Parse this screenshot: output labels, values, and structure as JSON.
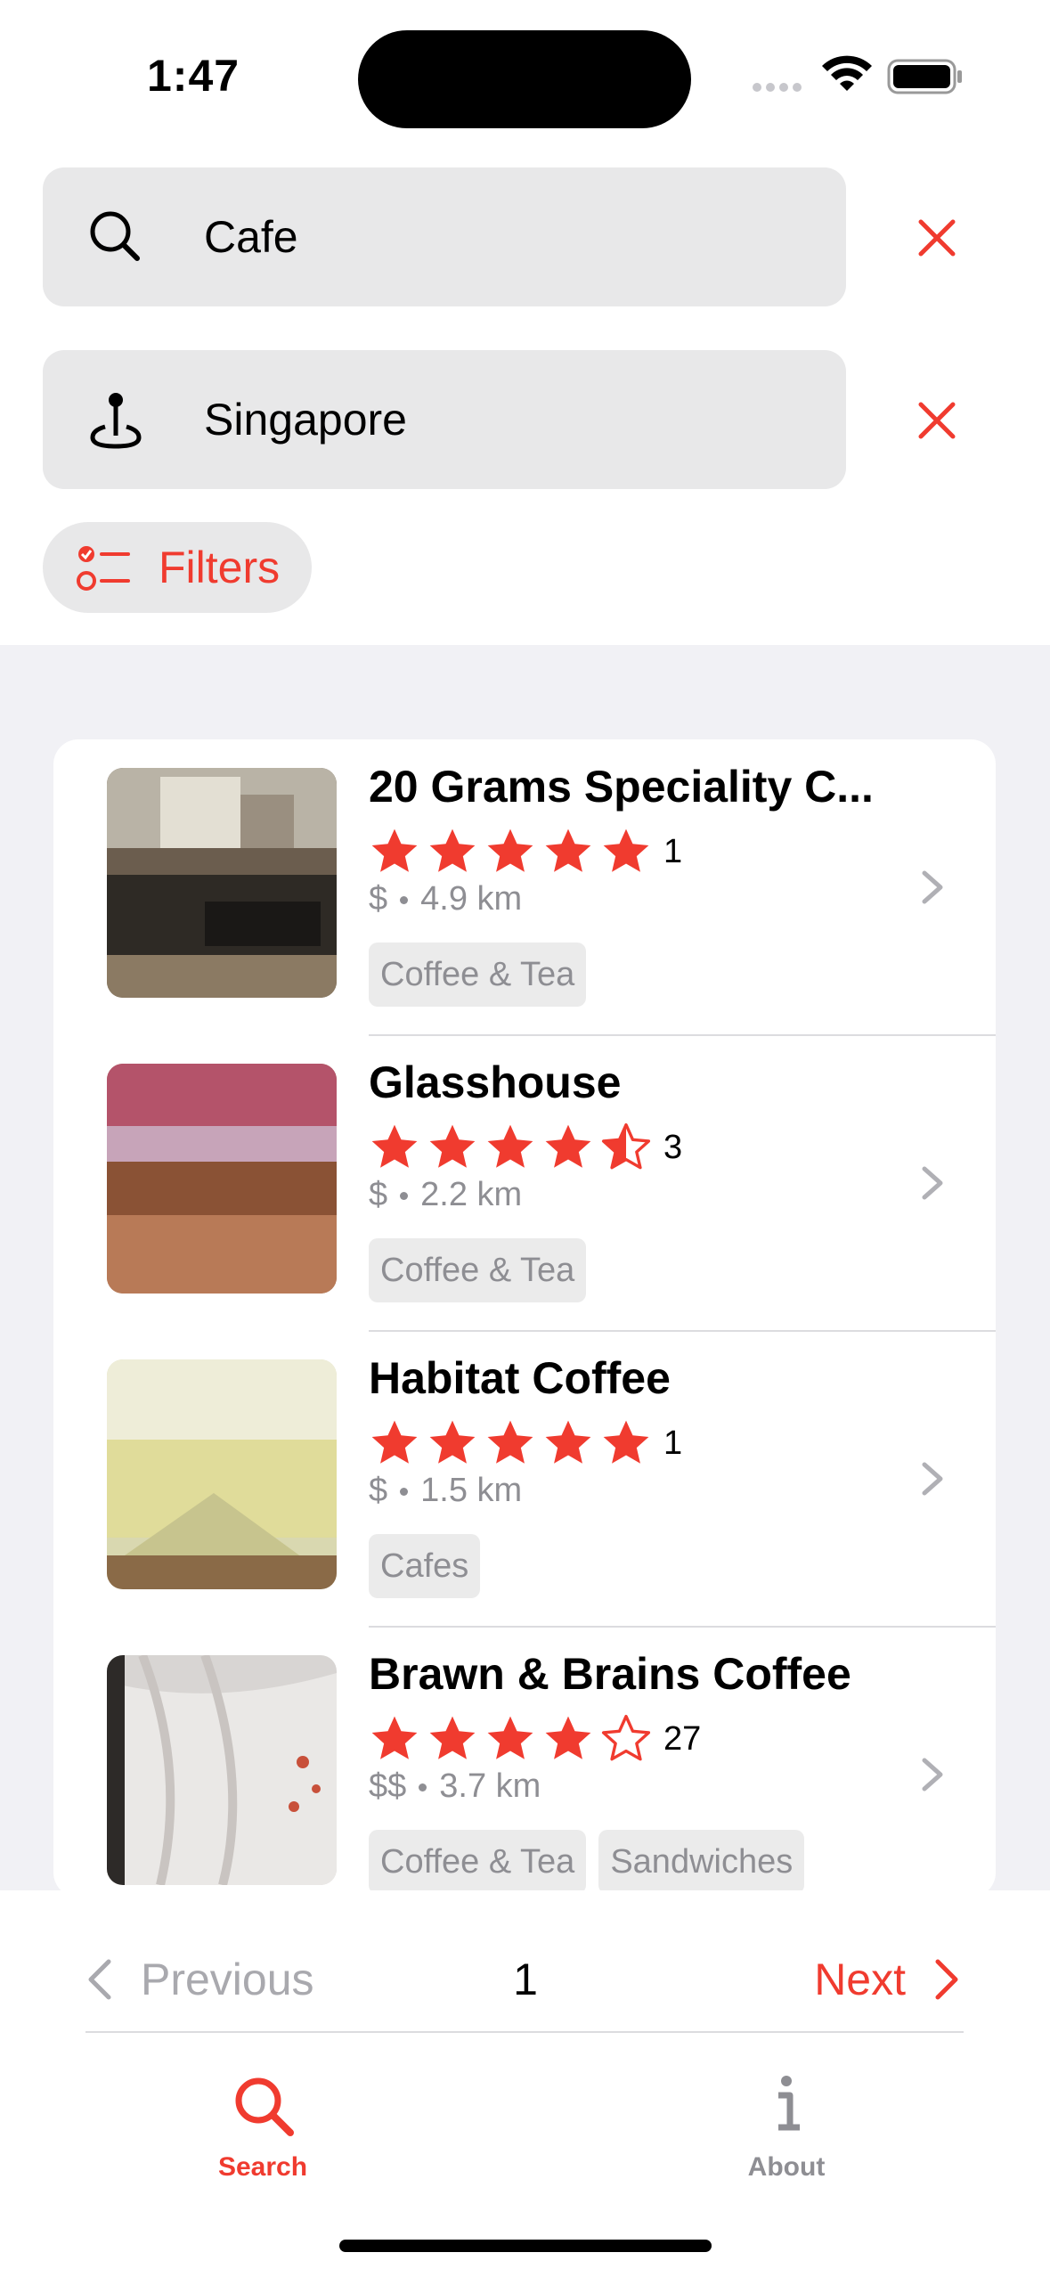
{
  "status": {
    "time": "1:47"
  },
  "search": {
    "query": "Cafe",
    "location": "Singapore",
    "filters_label": "Filters"
  },
  "results": [
    {
      "name": "20 Grams Speciality C...",
      "rating": 5,
      "reviews": "1",
      "price": "$",
      "distance": "4.9 km",
      "tags": [
        "Coffee & Tea"
      ]
    },
    {
      "name": "Glasshouse",
      "rating": 4.5,
      "reviews": "3",
      "price": "$",
      "distance": "2.2 km",
      "tags": [
        "Coffee & Tea"
      ]
    },
    {
      "name": "Habitat Coffee",
      "rating": 5,
      "reviews": "1",
      "price": "$",
      "distance": "1.5 km",
      "tags": [
        "Cafes"
      ]
    },
    {
      "name": "Brawn & Brains Coffee",
      "rating": 4,
      "reviews": "27",
      "price": "$$",
      "distance": "3.7 km",
      "tags": [
        "Coffee & Tea",
        "Sandwiches"
      ]
    }
  ],
  "pagination": {
    "previous": "Previous",
    "page": "1",
    "next": "Next"
  },
  "tabs": [
    {
      "label": "Search",
      "active": true
    },
    {
      "label": "About",
      "active": false
    }
  ],
  "colors": {
    "accent": "#f03b2f",
    "star": "#f03b2f",
    "muted": "#8e8e93",
    "field_bg": "#e8e8e9",
    "list_bg": "#f1f1f5"
  }
}
